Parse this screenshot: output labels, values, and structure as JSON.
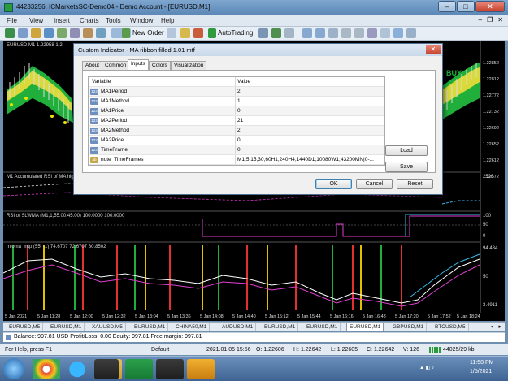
{
  "window": {
    "title": "44233256: ICMarketsSC-Demo04 - Demo Account - [EURUSD,M1]",
    "minimize": "–",
    "maximize": "□",
    "close": "✕"
  },
  "menu": [
    "File",
    "View",
    "Insert",
    "Charts",
    "Tools",
    "Window",
    "Help"
  ],
  "toolbar": {
    "new_order": "New Order",
    "autotrading": "AutoTrading"
  },
  "chart": {
    "main_label": "EURUSD,M1  1.22958 1.2",
    "buy_text": "BUY",
    "price_ticks": [
      "1.22852",
      "1.22812",
      "1.22772",
      "1.22732",
      "1.22692",
      "1.22652",
      "1.22612",
      "1.22572"
    ],
    "pane2_label": "M1 Accumulated RSI of MA high",
    "pane2_tick": "2520",
    "pane3_label": "RSI of SLWMA (M1,1,55.00,45.00) 100.0000 100.0000",
    "pane3_ticks": [
      "100",
      "50",
      "0"
    ],
    "pane4_label": "mloma_mtp  (55, -1) 74.6707 72.6707 80.8502",
    "pane4_ticks": [
      "94.484",
      "50",
      "3.4911"
    ],
    "time_ticks": [
      "5 Jan 2021",
      "5 Jan 11:28",
      "5 Jan 12:00",
      "5 Jan 12:32",
      "5 Jan 13:04",
      "5 Jan 13:36",
      "5 Jan 14:08",
      "5 Jan 14:40",
      "5 Jan 15:12",
      "5 Jan 15:44",
      "5 Jan 16:16",
      "5 Jan 16:48",
      "5 Jan 17:20",
      "5 Jan 17:52",
      "5 Jan 18:24"
    ]
  },
  "tabs": [
    "EURUSD,M5",
    "EURUSD,M1",
    "XAUUSD,M5",
    "EURUSD,M1",
    "CHINA50,M1",
    "AUDUSD,M1",
    "EURUSD,M1",
    "EURUSD,M1",
    "EURUSD,M1",
    "GBPUSD,M1",
    "BTCUSD,M5"
  ],
  "active_tab_index": 8,
  "terminal": {
    "text": "Balance: 997.81 USD  Profit/Loss: 0.00  Equity: 997.81  Free margin: 997.81"
  },
  "statusbar": {
    "help": "For Help, press F1",
    "profile": "Default",
    "datetime": "2021.01.05 15:56",
    "open": "O: 1.22606",
    "high": "H: 1.22642",
    "low": "L: 1.22605",
    "closev": "C: 1.22642",
    "volume": "V: 126",
    "traffic": "44025/29 kb"
  },
  "clock": {
    "time": "11:58 PM",
    "date": "1/5/2021"
  },
  "dialog": {
    "title": "Custom Indicator - MA ribbon filled 1.01 mtf",
    "close": "✕",
    "tabs": [
      "About",
      "Common",
      "Inputs",
      "Colors",
      "Visualization"
    ],
    "active_tab": 2,
    "col_variable": "Variable",
    "col_value": "Value",
    "rows": [
      {
        "icon": "123",
        "name": "MA1Period",
        "value": "2"
      },
      {
        "icon": "123",
        "name": "MA1Method",
        "value": "1"
      },
      {
        "icon": "123",
        "name": "MA1Price",
        "value": "0"
      },
      {
        "icon": "123",
        "name": "MA2Period",
        "value": "21"
      },
      {
        "icon": "123",
        "name": "MA2Method",
        "value": "2"
      },
      {
        "icon": "123",
        "name": "MA2Price",
        "value": "0"
      },
      {
        "icon": "123",
        "name": "TimeFrame",
        "value": "0"
      },
      {
        "icon": "ab",
        "name": "note_TimeFrames_",
        "value": "M1;5,15,30,60H1;240H4;1440D1;10080W1;43200MN|0-..."
      }
    ],
    "load": "Load",
    "save": "Save",
    "ok": "OK",
    "cancel": "Cancel",
    "reset": "Reset"
  },
  "colors": {
    "accent_green": "#1faf3a",
    "ribbon_yellow": "#d9d93a",
    "magenta": "#e040d0",
    "cyan": "#3ab8e8"
  }
}
